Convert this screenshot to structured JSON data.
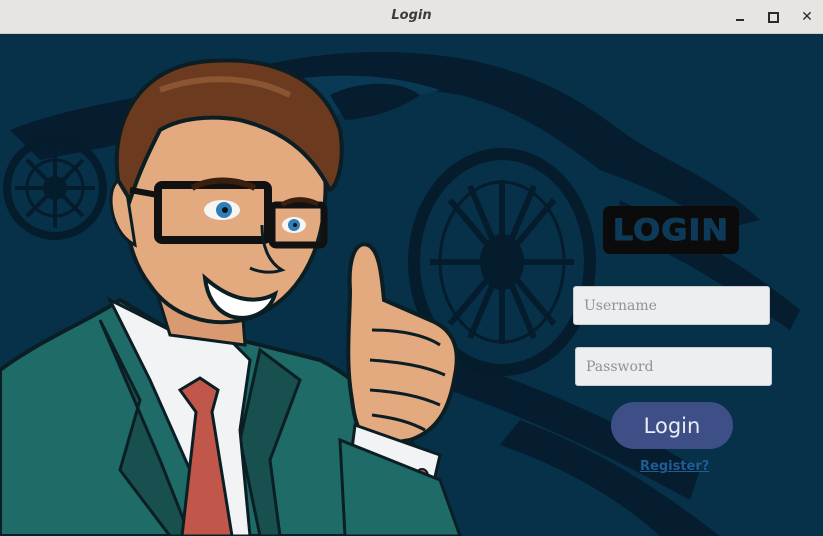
{
  "window": {
    "title": "Login"
  },
  "logo": {
    "text": "LOGIN"
  },
  "form": {
    "username_placeholder": "Username",
    "username_value": "",
    "password_placeholder": "Password",
    "password_value": "",
    "login_label": "Login",
    "register_label": "Register?"
  },
  "colors": {
    "background": "#073049",
    "button": "#3d4f86",
    "link": "#1f5d94",
    "logo_bg": "#0b0b0b"
  },
  "icons": {
    "minimize": "minimize-icon",
    "maximize": "maximize-icon",
    "close": "close-icon"
  }
}
